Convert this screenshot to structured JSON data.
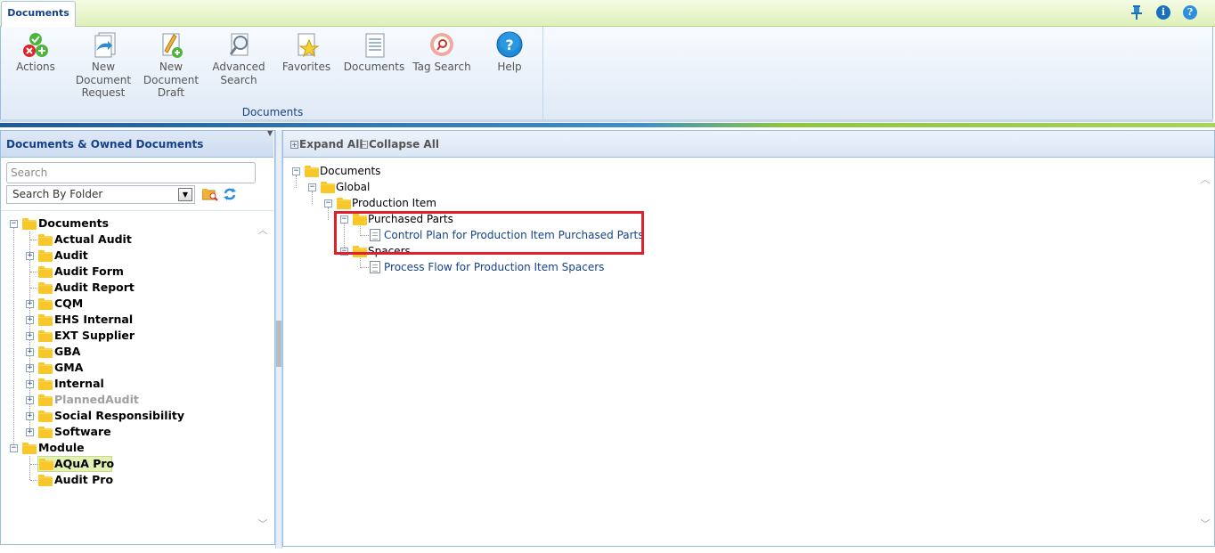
{
  "tab": {
    "label": "Documents"
  },
  "top_icons": [
    "pin-icon",
    "info-icon",
    "help-icon"
  ],
  "ribbon": {
    "buttons": [
      {
        "label": "Actions",
        "icon": "actions-icon"
      },
      {
        "label": "New Document Request",
        "line1": "New",
        "line2": "Document",
        "line3": "Request",
        "icon": "new-document-request-icon"
      },
      {
        "label": "New Document Draft",
        "line1": "New",
        "line2": "Document",
        "line3": "Draft",
        "icon": "new-document-draft-icon"
      },
      {
        "label": "Advanced Search",
        "line1": "Advanced",
        "line2": "Search",
        "icon": "magnifier-icon"
      },
      {
        "label": "Favorites",
        "icon": "star-icon"
      },
      {
        "label": "Documents",
        "icon": "documents-icon"
      },
      {
        "label": "Tag Search",
        "icon": "tag-search-icon"
      },
      {
        "label": "Help",
        "icon": "help-circle-icon"
      }
    ],
    "group_label": "Documents"
  },
  "left_panel": {
    "title": "Documents & Owned Documents",
    "search_placeholder": "Search",
    "folder_select": "Search By Folder",
    "tree": [
      {
        "label": "Documents",
        "expanded": true
      },
      {
        "label": "Actual Audit"
      },
      {
        "label": "Audit"
      },
      {
        "label": "Audit Form"
      },
      {
        "label": "Audit Report"
      },
      {
        "label": "CQM"
      },
      {
        "label": "EHS Internal"
      },
      {
        "label": "EXT Supplier"
      },
      {
        "label": "GBA"
      },
      {
        "label": "GMA"
      },
      {
        "label": "Internal"
      },
      {
        "label": "PlannedAudit",
        "disabled": true
      },
      {
        "label": "Social Responsibility"
      },
      {
        "label": "Software"
      },
      {
        "label": "Module",
        "expanded": true
      },
      {
        "label": "AQuA Pro",
        "selected": true
      },
      {
        "label": "Audit Pro"
      }
    ]
  },
  "right_panel": {
    "expand_all": "Expand All",
    "collapse_all": "Collapse All",
    "tree": {
      "root": "Documents",
      "global": "Global",
      "production_item": "Production Item",
      "purchased_parts": "Purchased Parts",
      "control_plan": "Control Plan for Production Item Purchased Parts",
      "spacers": "Spacers",
      "process_flow": "Process Flow for Production Item Spacers"
    }
  },
  "colors": {
    "highlight_box": "#e2202b",
    "selected_row": "#e2f2b5",
    "header_text": "#15428b"
  }
}
